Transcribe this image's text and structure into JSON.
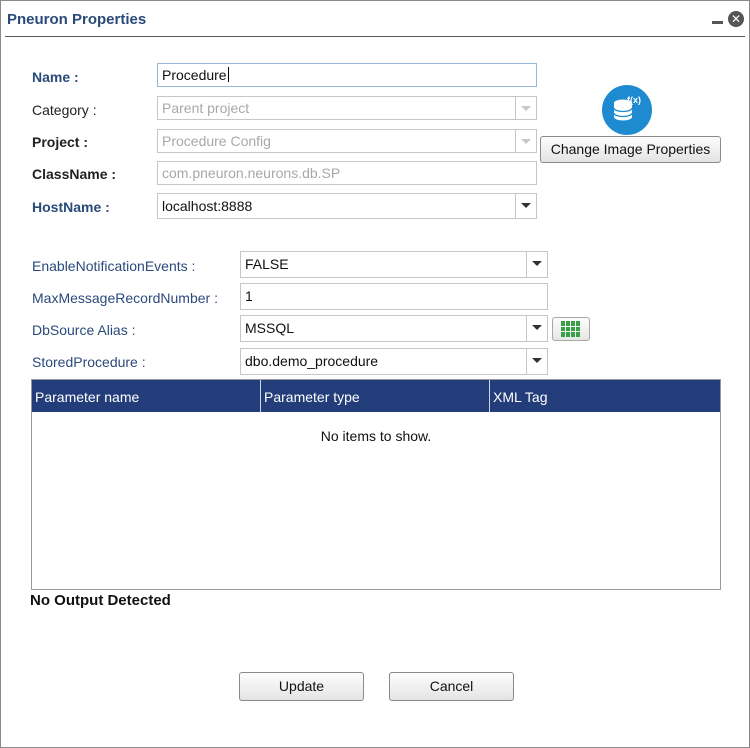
{
  "window": {
    "title": "Pneuron Properties"
  },
  "fields": {
    "name": {
      "label": "Name :",
      "value": "Procedure"
    },
    "category": {
      "label": "Category :",
      "value": "Parent project"
    },
    "project": {
      "label": "Project :",
      "value": "Procedure Config"
    },
    "classname": {
      "label": "ClassName :",
      "value": "com.pneuron.neurons.db.SP"
    },
    "hostname": {
      "label": "HostName :",
      "value": "localhost:8888"
    },
    "enable_notification": {
      "label": "EnableNotificationEvents :",
      "value": "FALSE"
    },
    "max_message": {
      "label": "MaxMessageRecordNumber :",
      "value": "1"
    },
    "dbsource": {
      "label": "DbSource Alias :",
      "value": "MSSQL"
    },
    "stored_procedure": {
      "label": "StoredProcedure :",
      "value": "dbo.demo_procedure"
    }
  },
  "change_image_button": "Change Image Properties",
  "icons": {
    "image": "database-function-icon",
    "grid": "grid-table-icon"
  },
  "table": {
    "columns": [
      "Parameter name",
      "Parameter type",
      "XML Tag"
    ],
    "empty_message": "No items to show."
  },
  "status": "No Output Detected",
  "buttons": {
    "update": "Update",
    "cancel": "Cancel"
  },
  "colors": {
    "header": "#223d7a",
    "label": "#2a4a7a",
    "icon": "#1e8ad0"
  }
}
